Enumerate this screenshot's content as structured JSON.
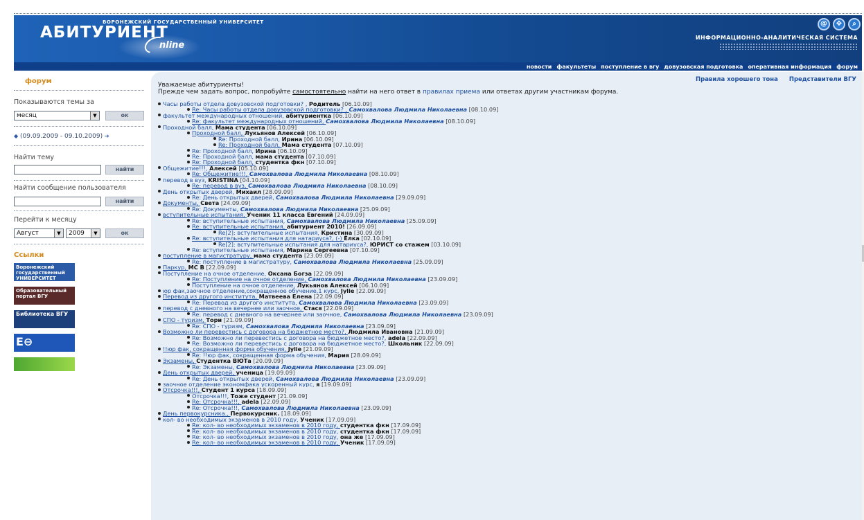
{
  "header": {
    "university_small": "ВОРОНЕЖСКИЙ ГОСУДАРСТВЕННЫЙ УНИВЕРСИТЕТ",
    "brand": "АБИТУРИЕНТ",
    "brand_suffix": "nline",
    "system_title": "ИНФОРМАЦИОННО-АНАЛИТИЧЕСКАЯ СИСТЕМА",
    "icons": [
      "at-icon",
      "globe-icon",
      "search-icon"
    ]
  },
  "nav": {
    "items": [
      "новости",
      "факультеты",
      "поступление в вгу",
      "довузовская подготовка",
      "оперативная информация",
      "форум"
    ]
  },
  "sidebar": {
    "title": "форум",
    "show_topics_label": "Показываются темы за",
    "period_value": "месяц",
    "ok_label": "ок",
    "range_text": "(09.09.2009 - 09.10.2009)",
    "find_topic_label": "Найти тему",
    "find_button": "найти",
    "find_user_label": "Найти сообщение пользователя",
    "goto_month_label": "Перейти к месяцу",
    "month_value": "Август",
    "year_value": "2009",
    "links_title": "Ссылки",
    "banners": [
      "Воронежский государственный УНИВЕРСИТЕТ",
      "Образовательный портал ВГУ",
      "Библиотека ВГУ",
      "",
      ""
    ]
  },
  "content": {
    "top_links": [
      "Правила хорошего тона",
      "Представители ВГУ"
    ],
    "greeting_1": "Уважаемые абитуриенты!",
    "greeting_2a": "Прежде чем задать вопрос, попробуйте ",
    "greeting_2b": "самостоятельно",
    "greeting_2c": " найти на него ответ в ",
    "greeting_2d": "правилах приема",
    "greeting_2e": " или ответах другим участникам форума.",
    "posts": [
      {
        "lvl": 0,
        "title": "Часы работы отдела довузовской подготовки? ,",
        "author": "Родитель",
        "date": "[06.10.09]"
      },
      {
        "lvl": 1,
        "title": "Re: Часы работы отдела довузовской подготовки? ,",
        "author": "Самохвалова Людмила Николаевна",
        "mod": true,
        "date": "[08.10.09]"
      },
      {
        "lvl": 0,
        "title": "факультет международных отношений,",
        "author": "абитуриентка",
        "date": "[06.10.09]"
      },
      {
        "lvl": 1,
        "title": "Re: факультет международных отношений,",
        "author": "Самохвалова Людмила Николаевна",
        "mod": true,
        "date": "[08.10.09]"
      },
      {
        "lvl": 0,
        "title": "Проходной балл,",
        "author": "Мама студента",
        "date": "[06.10.09]"
      },
      {
        "lvl": 1,
        "title": "Проходной балл,",
        "author": "Лукьянов Алексей",
        "date": "[06.10.09]"
      },
      {
        "lvl": 2,
        "title": "Re: Проходной балл,",
        "author": "Ирина",
        "date": "[06.10.09]"
      },
      {
        "lvl": 2,
        "title": "Re: Проходной балл,",
        "author": "Мама студента",
        "date": "[07.10.09]"
      },
      {
        "lvl": 1,
        "title": "Re: Проходной балл,",
        "author": "Ирина",
        "date": "[06.10.09]"
      },
      {
        "lvl": 1,
        "title": "Re: Проходной балл,",
        "author": "мама студента",
        "date": "[07.10.09]"
      },
      {
        "lvl": 1,
        "title": "Re: Проходной балл,",
        "author": "студентка фкн",
        "date": "[07.10.09]"
      },
      {
        "lvl": 0,
        "title": "Общежитие!!!,",
        "author": "Алексей",
        "date": "[05.10.09]"
      },
      {
        "lvl": 1,
        "title": "Re: Общежитие!!!,",
        "author": "Самохвалова Людмила Николаевна",
        "mod": true,
        "date": "[08.10.09]"
      },
      {
        "lvl": 0,
        "title": "перевод в вуз,",
        "author": "KRISTINA",
        "date": "[04.10.09]"
      },
      {
        "lvl": 1,
        "title": "Re: перевод в вуз,",
        "author": "Самохвалова Людмила Николаевна",
        "mod": true,
        "date": "[08.10.09]"
      },
      {
        "lvl": 0,
        "title": "День открытых дверей,",
        "author": "Михаил",
        "date": "[28.09.09]"
      },
      {
        "lvl": 1,
        "title": "Re: День открытых дверей,",
        "author": "Самохвалова Людмила Николаевна",
        "mod": true,
        "date": "[29.09.09]"
      },
      {
        "lvl": 0,
        "title": "Документы,",
        "author": "Света",
        "date": "[24.09.09]"
      },
      {
        "lvl": 1,
        "title": "Re: Документы,",
        "author": "Самохвалова Людмила Николаевна",
        "mod": true,
        "date": "[25.09.09]"
      },
      {
        "lvl": 0,
        "title": "вступительные испытания,",
        "author": "Ученик 11 класса Евгений",
        "date": "[24.09.09]"
      },
      {
        "lvl": 1,
        "title": "Re: вступительные испытания,",
        "author": "Самохвалова Людмила Николаевна",
        "mod": true,
        "date": "[25.09.09]"
      },
      {
        "lvl": 1,
        "title": "Re: вступительные испытания,",
        "author": "абитуриент 2010!",
        "date": "[26.09.09]"
      },
      {
        "lvl": 2,
        "title": "Re[2]: вступительные испытания,",
        "author": "Кристина",
        "date": "[30.09.09]"
      },
      {
        "lvl": 1,
        "title": "Re: вступительные испытания для натариуса?, (-)",
        "author": "Ёлка",
        "date": "[02.10.09]"
      },
      {
        "lvl": 2,
        "title": "Re[2]: вступительные испытания для натариуса?,",
        "author": "ЮРИСТ со стажем",
        "date": "[03.10.09]"
      },
      {
        "lvl": 1,
        "title": "Re: вступительные испытания,",
        "author": "Марина Сергеевна",
        "date": "[07.10.09]"
      },
      {
        "lvl": 0,
        "title": "поступление в магистратуру,",
        "author": "мама студента",
        "date": "[23.09.09]"
      },
      {
        "lvl": 1,
        "title": "Re: поступление в магистратуру,",
        "author": "Самохвалова Людмила Николаевна",
        "mod": true,
        "date": "[25.09.09]"
      },
      {
        "lvl": 0,
        "title": "Паркур,",
        "author": "MC B",
        "date": "[22.09.09]"
      },
      {
        "lvl": 0,
        "title": "Поступление на очное отделение,",
        "author": "Оксана Богза",
        "date": "[22.09.09]"
      },
      {
        "lvl": 1,
        "title": "Re: Поступление на очное отделение,",
        "author": "Самохвалова Людмила Николаевна",
        "mod": true,
        "date": "[23.09.09]"
      },
      {
        "lvl": 1,
        "title": "Поступление на очное отделение,",
        "author": "Лукьянов Алексей",
        "date": "[06.10.09]"
      },
      {
        "lvl": 0,
        "title": "юр фак,заочное отделение,сокращенное обучение,1 курс,",
        "author": "Jylie",
        "date": "[22.09.09]"
      },
      {
        "lvl": 0,
        "title": "Перевод из другого института,",
        "author": "Матвеева Елена",
        "date": "[22.09.09]"
      },
      {
        "lvl": 1,
        "title": "Re: Перевод из другого института,",
        "author": "Самохвалова Людмила Николаевна",
        "mod": true,
        "date": "[23.09.09]"
      },
      {
        "lvl": 0,
        "title": "перевод с дневного на вечернее или заочное,",
        "author": "Стася",
        "date": "[22.09.09]"
      },
      {
        "lvl": 1,
        "title": "Re: перевод с дневного на вечернее или заочное,",
        "author": "Самохвалова Людмила Николаевна",
        "mod": true,
        "date": "[23.09.09]"
      },
      {
        "lvl": 0,
        "title": "СПО - туризм,",
        "author": "Тори",
        "date": "[21.09.09]"
      },
      {
        "lvl": 1,
        "title": "Re: СПО - туризм,",
        "author": "Самохвалова Людмила Николаевна",
        "mod": true,
        "date": "[23.09.09]"
      },
      {
        "lvl": 0,
        "title": "Возможно ли перевестись с договора на бюджетное место?,",
        "author": "Людмила Ивановна",
        "date": "[21.09.09]"
      },
      {
        "lvl": 1,
        "title": "Re: Возможно ли перевестись с договора на бюджетное место?,",
        "author": "adela",
        "date": "[22.09.09]"
      },
      {
        "lvl": 1,
        "title": "Re: Возможно ли перевестись с договора на бюджетное место?,",
        "author": "Школьник",
        "date": "[22.09.09]"
      },
      {
        "lvl": 0,
        "title": "!!юр фак, сокращенная форма обучения,",
        "author": "Jylie",
        "date": "[21.09.09]"
      },
      {
        "lvl": 1,
        "title": "Re: !!юр фак, сокращенная форма обучения,",
        "author": "Мария",
        "date": "[28.09.09]"
      },
      {
        "lvl": 0,
        "title": "Экзамены,",
        "author": "Студентка ВЮТа",
        "date": "[20.09.09]"
      },
      {
        "lvl": 1,
        "title": "Re: Экзамены,",
        "author": "Самохвалова Людмила Николаевна",
        "mod": true,
        "date": "[23.09.09]"
      },
      {
        "lvl": 0,
        "title": "День открытых дверей,",
        "author": "ученица",
        "date": "[19.09.09]"
      },
      {
        "lvl": 1,
        "title": "Re: День открытых дверей,",
        "author": "Самохвалова Людмила Николаевна",
        "mod": true,
        "date": "[23.09.09]"
      },
      {
        "lvl": 0,
        "title": "заочное отделение экономфака ускоренный курс,",
        "author": "я",
        "date": "[19.09.09]"
      },
      {
        "lvl": 0,
        "title": "Отсрочка!!!,",
        "author": "Студент 1 курса",
        "date": "[18.09.09]"
      },
      {
        "lvl": 1,
        "title": "Отсрочка!!!,",
        "author": "Тоже студент",
        "date": "[21.09.09]"
      },
      {
        "lvl": 1,
        "title": "Re: Отсрочка!!!,",
        "author": "adela",
        "date": "[22.09.09]"
      },
      {
        "lvl": 1,
        "title": "Re: Отсрочка!!!,",
        "author": "Самохвалова Людмила Николаевна",
        "mod": true,
        "date": "[23.09.09]"
      },
      {
        "lvl": 0,
        "title": "День первокурсника.,",
        "author": "Первокурсник.",
        "date": "[18.09.09]"
      },
      {
        "lvl": 0,
        "title": "кол- во необходимых экзаменов в 2010 году,",
        "author": "Ученик",
        "date": "[17.09.09]"
      },
      {
        "lvl": 1,
        "title": "Re: кол- во необходимых экзаменов в 2010 году,",
        "author": "студентка фкн",
        "date": "[17.09.09]"
      },
      {
        "lvl": 1,
        "title": "Re: кол- во необходимых экзаменов в 2010 году,",
        "author": "студентка фкн",
        "date": "[17.09.09]"
      },
      {
        "lvl": 1,
        "title": "Re: кол- во необходимых экзаменов в 2010 году,",
        "author": "она же",
        "date": "[17.09.09]"
      },
      {
        "lvl": 1,
        "title": "Re: кол- во необходимых экзаменов в 2010 году,",
        "author": "Ученик",
        "date": "[17.09.09]"
      }
    ]
  },
  "colors": {
    "header_blue": "#154f96",
    "nav_blue": "#0f3f88",
    "link_blue": "#1c4fa0",
    "accent_orange": "#d28a1c",
    "content_bg": "#e7eef6"
  }
}
